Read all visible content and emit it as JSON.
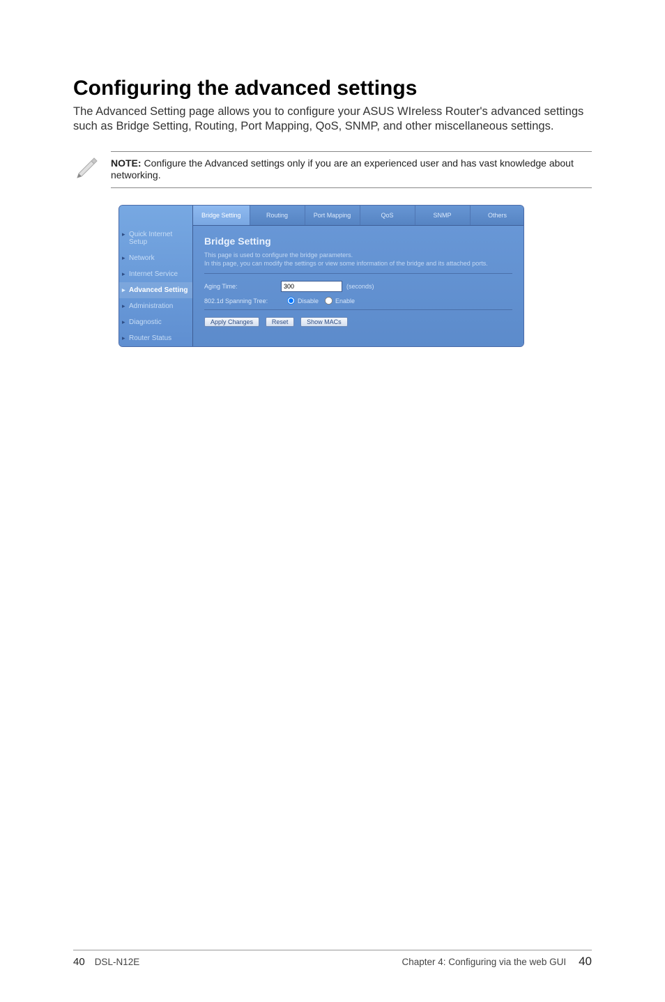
{
  "heading": "Configuring the advanced settings",
  "intro": "The Advanced Setting page allows you to configure your ASUS WIreless Router's advanced settings such as Bridge Setting, Routing, Port Mapping, QoS, SNMP, and other miscellaneous settings.",
  "note": {
    "label": "NOTE:",
    "text": " Configure the Advanced settings only if you are an experienced user and has vast knowledge about networking."
  },
  "router": {
    "sidebar": [
      "Quick Internet Setup",
      "Network",
      "Internet Service",
      "Advanced Setting",
      "Administration",
      "Diagnostic",
      "Router Status"
    ],
    "sidebar_active_index": 3,
    "tabs": [
      "Bridge Setting",
      "Routing",
      "Port Mapping",
      "QoS",
      "SNMP",
      "Others"
    ],
    "tab_active_index": 0,
    "panel": {
      "title": "Bridge Setting",
      "desc1": "This page is used to configure the bridge parameters.",
      "desc2": "In this page, you can modify the settings or view some information of the bridge and its attached ports.",
      "aging_label": "Aging Time:",
      "aging_value": "300",
      "aging_unit": "(seconds)",
      "spanning_label": "802.1d Spanning Tree:",
      "opt_disable": "Disable",
      "opt_enable": "Enable",
      "btn_apply": "Apply Changes",
      "btn_reset": "Reset",
      "btn_show": "Show MACs"
    }
  },
  "footer": {
    "page_left": "40",
    "model": "DSL-N12E",
    "chapter": "Chapter 4: Configuring via the web GUI",
    "page_right": "40"
  }
}
